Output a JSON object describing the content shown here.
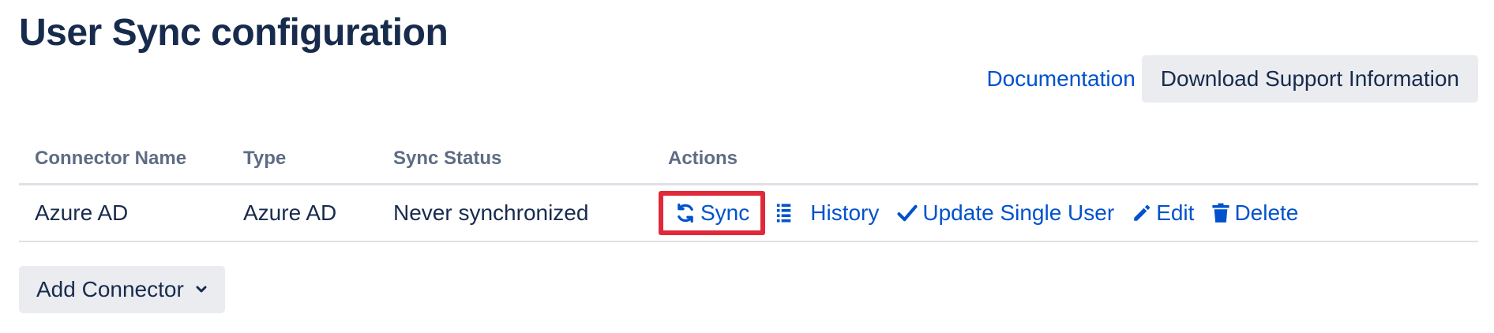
{
  "page": {
    "title": "User Sync configuration"
  },
  "header": {
    "documentation_link": "Documentation",
    "download_button": "Download Support Information"
  },
  "table": {
    "columns": [
      "Connector Name",
      "Type",
      "Sync Status",
      "Actions"
    ],
    "rows": [
      {
        "name": "Azure AD",
        "type": "Azure AD",
        "status": "Never synchronized",
        "actions": {
          "sync": "Sync",
          "history": "History",
          "update_single_user": "Update Single User",
          "edit": "Edit",
          "delete": "Delete"
        }
      }
    ]
  },
  "footer": {
    "add_connector": "Add Connector"
  },
  "colors": {
    "link": "#0052cc",
    "text": "#172b4d",
    "header_text": "#5e6c84",
    "button_bg": "#ebecf0",
    "highlight": "#e0293a"
  },
  "icons": {
    "sync": "sync-icon",
    "history": "list-icon",
    "update_single_user": "check-icon",
    "edit": "pencil-icon",
    "delete": "trash-icon",
    "dropdown": "chevron-down-icon"
  }
}
